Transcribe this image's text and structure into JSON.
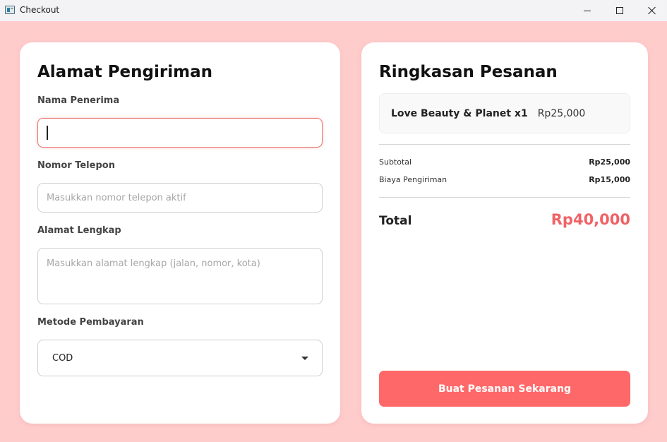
{
  "window": {
    "title": "Checkout"
  },
  "shipping": {
    "heading": "Alamat Pengiriman",
    "name_label": "Nama Penerima",
    "name_value": "",
    "phone_label": "Nomor Telepon",
    "phone_placeholder": "Masukkan nomor telepon aktif",
    "address_label": "Alamat Lengkap",
    "address_placeholder": "Masukkan alamat lengkap (jalan, nomor, kota)",
    "payment_label": "Metode Pembayaran",
    "payment_selected": "COD"
  },
  "summary": {
    "heading": "Ringkasan Pesanan",
    "items": [
      {
        "name": "Love Beauty & Planet x1",
        "price": "Rp25,000"
      }
    ],
    "subtotal_label": "Subtotal",
    "subtotal_value": "Rp25,000",
    "shipping_label": "Biaya Pengiriman",
    "shipping_value": "Rp15,000",
    "total_label": "Total",
    "total_value": "Rp40,000",
    "submit_label": "Buat Pesanan Sekarang"
  },
  "colors": {
    "background": "#ffcccc",
    "accent": "#ff6868",
    "total": "#f06266",
    "focus_border": "#e8706e"
  }
}
